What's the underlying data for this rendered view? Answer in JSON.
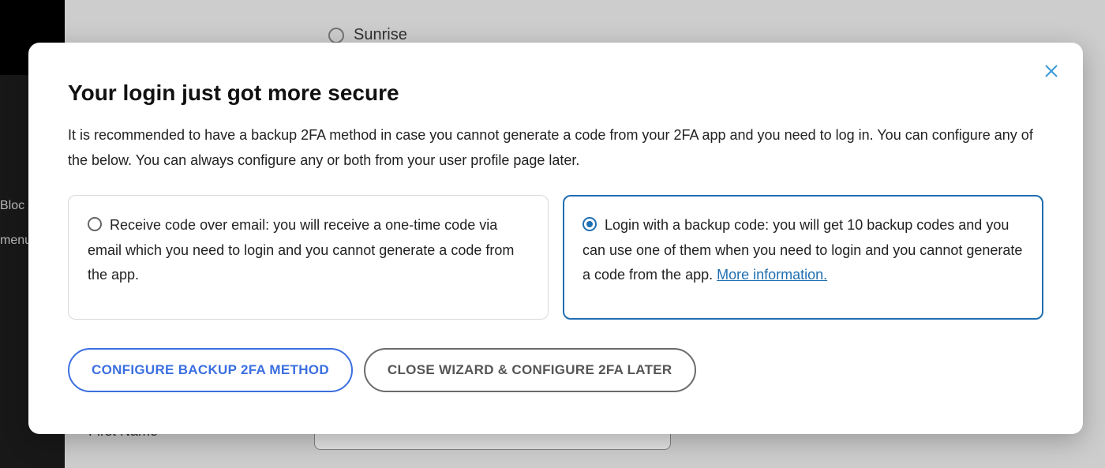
{
  "background": {
    "sidebar_label1": "Bloc",
    "sidebar_label2": "menu",
    "radio_option": "Sunrise",
    "field_label": "First Name"
  },
  "modal": {
    "title": "Your login just got more secure",
    "description": "It is recommended to have a backup 2FA method in case you cannot generate a code from your 2FA app and you need to log in. You can configure any of the below. You can always configure any or both from your user profile page later.",
    "options": {
      "email": {
        "text": "Receive code over email: you will receive a one-time code via email which you need to login and you cannot generate a code from the app.",
        "selected": false
      },
      "backup_code": {
        "text": "Login with a backup code: you will get 10 backup codes and you can use one of them when you need to login and you cannot generate a code from the app. ",
        "more_link": "More information.",
        "selected": true
      }
    },
    "buttons": {
      "configure": "CONFIGURE BACKUP 2FA METHOD",
      "close": "CLOSE WIZARD & CONFIGURE 2FA LATER"
    }
  }
}
